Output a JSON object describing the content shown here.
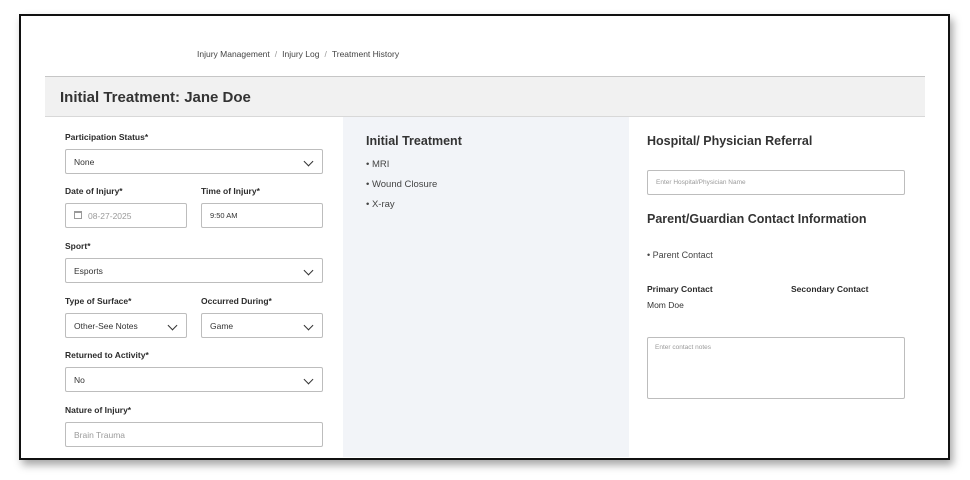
{
  "breadcrumb": {
    "items": [
      "Injury Management",
      "Injury Log",
      "Treatment History"
    ],
    "separator": "/"
  },
  "page": {
    "title": "Initial Treatment: Jane Doe"
  },
  "form": {
    "participation_status": {
      "label": "Participation Status*",
      "value": "None"
    },
    "date_of_injury": {
      "label": "Date of Injury*",
      "placeholder": "08-27-2025"
    },
    "time_of_injury": {
      "label": "Time of Injury*",
      "value": "9:50 AM"
    },
    "sport": {
      "label": "Sport*",
      "value": "Esports"
    },
    "type_of_surface": {
      "label": "Type of Surface*",
      "value": "Other-See Notes"
    },
    "occurred_during": {
      "label": "Occurred During*",
      "value": "Game"
    },
    "returned_to_activity": {
      "label": "Returned to Activity*",
      "value": "No"
    },
    "nature_of_injury": {
      "label": "Nature of Injury*",
      "placeholder": "Brain Trauma"
    }
  },
  "initial_treatment": {
    "title": "Initial Treatment",
    "items": [
      "MRI",
      "Wound Closure",
      "X-ray"
    ]
  },
  "referral": {
    "title": "Hospital/ Physician Referral",
    "placeholder": "Enter Hospital/Physician Name"
  },
  "guardian": {
    "title": "Parent/Guardian Contact Information",
    "items": [
      "Parent Contact"
    ],
    "primary_label": "Primary Contact",
    "primary_value": "Mom Doe",
    "secondary_label": "Secondary Contact",
    "notes_placeholder": "Enter contact notes"
  }
}
